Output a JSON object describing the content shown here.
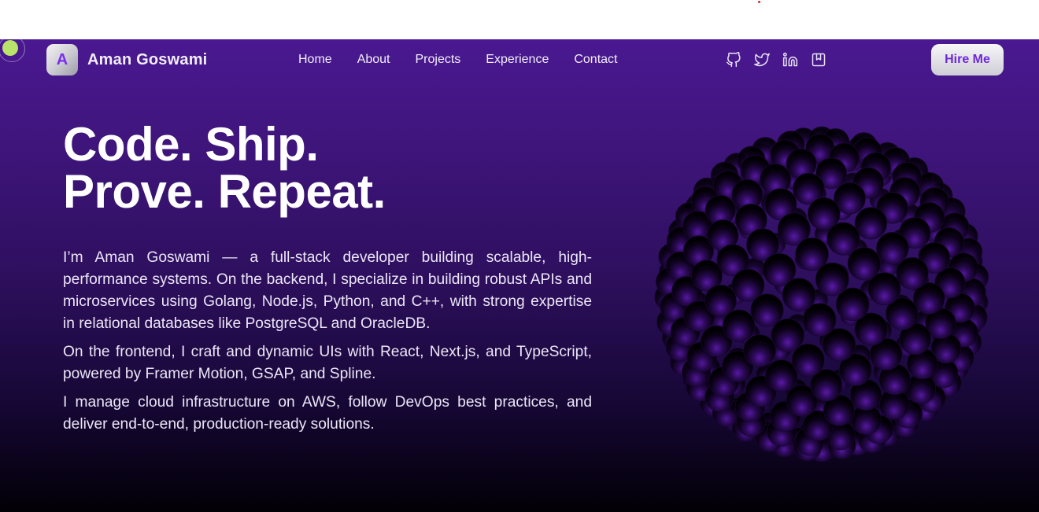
{
  "nav": {
    "logo_letter": "A",
    "brand": "Aman Goswami",
    "links": [
      "Home",
      "About",
      "Projects",
      "Experience",
      "Contact"
    ],
    "socials": [
      "github-icon",
      "twitter-icon",
      "linkedin-icon",
      "book-icon"
    ],
    "hire_label": "Hire Me"
  },
  "hero": {
    "headline_line1": "Code. Ship.",
    "headline_line2": "Prove. Repeat.",
    "paragraphs": [
      "I’m Aman Goswami — a full-stack developer building scalable, high-performance systems. On the backend, I specialize in building robust APIs and microservices using Golang, Node.js, Python, and C++, with strong expertise in relational databases like PostgreSQL and OracleDB.",
      "On the frontend, I craft and dynamic UIs with React, Next.js, and TypeScript, powered by Framer Motion, GSAP, and Spline.",
      "I manage cloud infrastructure on AWS, follow DevOps best practices, and deliver end-to-end, production-ready solutions."
    ]
  },
  "colors": {
    "accent": "#6d28d9",
    "cursor": "#b9e36a",
    "bg_top": "#4a1891",
    "bg_bottom": "#020006"
  }
}
